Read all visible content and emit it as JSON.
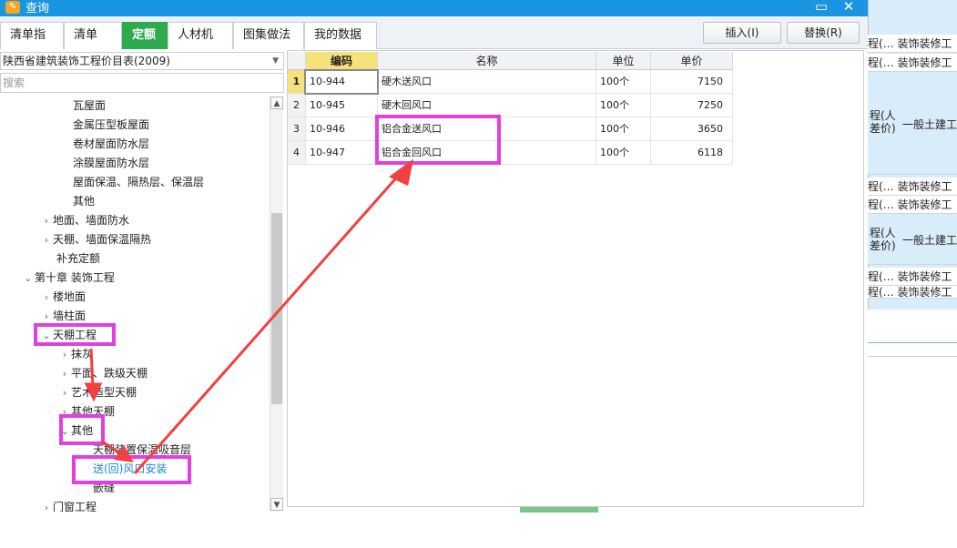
{
  "window": {
    "title": "查询",
    "min_icon": "minimize-icon",
    "close_icon": "close-icon"
  },
  "tabs": [
    {
      "label": "清单指引",
      "active": false
    },
    {
      "label": "清单",
      "active": false
    },
    {
      "label": "定额",
      "active": true
    },
    {
      "label": "人材机",
      "active": false
    },
    {
      "label": "图集做法",
      "active": false
    },
    {
      "label": "我的数据",
      "active": false
    }
  ],
  "actions": {
    "insert": "插入(I)",
    "replace": "替换(R)"
  },
  "left": {
    "dropdown_value": "陕西省建筑装饰工程价目表(2009)",
    "search_placeholder": "搜索",
    "tree": [
      {
        "label": "瓦屋面",
        "arrow": ""
      },
      {
        "label": "金属压型板屋面",
        "arrow": ""
      },
      {
        "label": "卷材屋面防水层",
        "arrow": ""
      },
      {
        "label": "涂膜屋面防水层",
        "arrow": ""
      },
      {
        "label": "屋面保温、隔热层、保温层",
        "arrow": ""
      },
      {
        "label": "其他",
        "arrow": ""
      },
      {
        "label": "地面、墙面防水",
        "arrow": "›"
      },
      {
        "label": "天棚、墙面保温隔热",
        "arrow": "›"
      },
      {
        "label": "补充定额",
        "arrow": ""
      },
      {
        "label": "第十章 装饰工程",
        "arrow": "⌄"
      },
      {
        "label": "楼地面",
        "arrow": "›"
      },
      {
        "label": "墙柱面",
        "arrow": "›"
      },
      {
        "label": "天棚工程",
        "arrow": "⌄"
      },
      {
        "label": "抹灰",
        "arrow": "›"
      },
      {
        "label": "平面、跌级天棚",
        "arrow": "›"
      },
      {
        "label": "艺术造型天棚",
        "arrow": "›"
      },
      {
        "label": "其他天棚",
        "arrow": "›"
      },
      {
        "label": "其他",
        "arrow": "⌄"
      },
      {
        "label": "天棚装置保温吸音层",
        "arrow": ""
      },
      {
        "label": "送(回)风口安装",
        "arrow": ""
      },
      {
        "label": "嵌缝",
        "arrow": ""
      },
      {
        "label": "门窗工程",
        "arrow": "›"
      }
    ]
  },
  "grid": {
    "headers": [
      "编码",
      "名称",
      "单位",
      "单价"
    ],
    "rows": [
      {
        "num": "1",
        "code": "10-944",
        "name": "硬木送风口",
        "unit": "100个",
        "price": "7150"
      },
      {
        "num": "2",
        "code": "10-945",
        "name": "硬木回风口",
        "unit": "100个",
        "price": "7250"
      },
      {
        "num": "3",
        "code": "10-946",
        "name": "铝合金送风口",
        "unit": "100个",
        "price": "3650"
      },
      {
        "num": "4",
        "code": "10-947",
        "name": "铝合金回风口",
        "unit": "100个",
        "price": "6118"
      }
    ]
  },
  "right": {
    "rows": [
      {
        "a": "程(…",
        "b": "装饰装修工"
      },
      {
        "a": "程(…",
        "b": "装饰装修工"
      },
      {
        "a": "程(人差价)",
        "b": "一般土建工"
      },
      {
        "a": "程(…",
        "b": "装饰装修工"
      },
      {
        "a": "程(…",
        "b": "装饰装修工"
      },
      {
        "a": "程(人差价)",
        "b": "一般土建工"
      },
      {
        "a": "程(…",
        "b": "装饰装修工"
      },
      {
        "a": "程(…",
        "b": "装饰装修工"
      }
    ]
  },
  "colors": {
    "accent_green": "#2eab4f",
    "titlebar_blue": "#1a95e2",
    "highlight_magenta": "#e23fe0",
    "arrow_red": "#f04040"
  }
}
